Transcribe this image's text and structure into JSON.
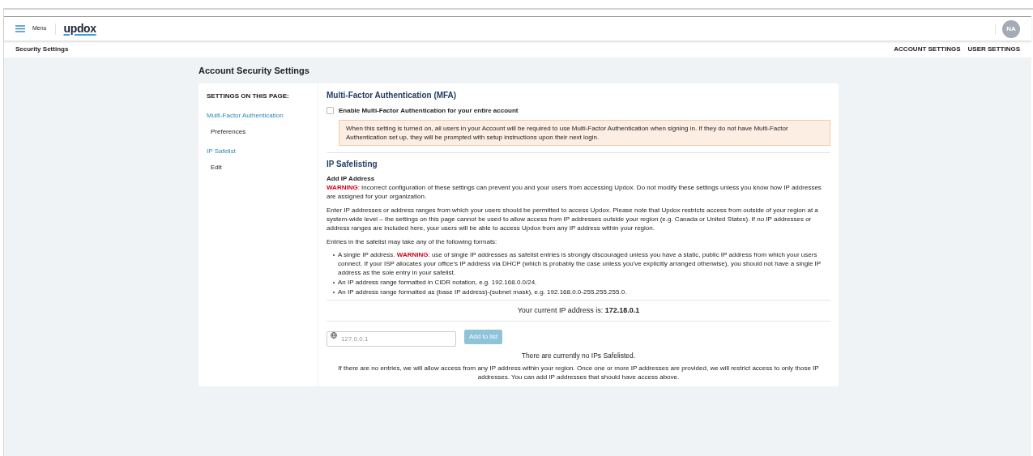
{
  "header": {
    "menu_label": "Menu",
    "logo": "updox",
    "avatar": "NA"
  },
  "subheader": {
    "title": "Security Settings",
    "links": [
      "ACCOUNT SETTINGS",
      "USER SETTINGS"
    ]
  },
  "page_title": "Account Security Settings",
  "nav": {
    "title": "SETTINGS ON THIS PAGE:",
    "sections": [
      {
        "label": "Multi-Factor Authentication",
        "children": [
          {
            "label": "Preferences"
          }
        ]
      },
      {
        "label": "IP Safelist",
        "children": [
          {
            "label": "Edit"
          }
        ]
      }
    ]
  },
  "mfa": {
    "heading": "Multi-Factor Authentication (MFA)",
    "checkbox": {
      "label": "Enable Multi-Factor Authentication for your entire account",
      "checked": false
    },
    "notice": "When this setting is turned on, all users in your Account will be required to use Multi-Factor Authentication when signing in. If they do not have Multi-Factor Authentication set up, they will be prompted with setup instructions upon their next login."
  },
  "ip": {
    "heading": "IP Safelisting",
    "subheading": "Add IP Address",
    "warning": [
      {
        "kind": "warning",
        "text": "WARNING"
      },
      {
        "kind": "plain",
        "text": ": Incorrect configuration of these settings can prevent you and your users from accessing Updox. Do not modify these settings unless you know how IP addresses are assigned for your organization."
      }
    ],
    "paragraph": "Enter IP addresses or address ranges from which your users should be permitted to access Updox. Please note that Updox restricts access from outside of your region at a system-wide level – the settings on this page cannot be used to allow access from IP addresses outside your region (e.g. Canada or United States). If no IP addresses or address ranges are included here, your users will be able to access Updox from any IP address within your region.",
    "formats_intro": "Entries in the safelist may take any of the following formats:",
    "formats": [
      [
        {
          "kind": "plain",
          "text": "A single IP address. "
        },
        {
          "kind": "warning",
          "text": "WARNING"
        },
        {
          "kind": "plain",
          "text": ": use of single IP addresses as safelist entries is strongly discouraged unless you have a static, public IP address from which your users connect. If your ISP allocates your office's IP address via DHCP (which is probably the case unless you've explicitly arranged otherwise), you should not have a single IP address as the sole entry in your safelist."
        }
      ],
      [
        {
          "kind": "plain",
          "text": "An IP address range formatted in CIDR notation, e.g. 192.168.0.0/24."
        }
      ],
      [
        {
          "kind": "plain",
          "text": "An IP address range formatted as (base IP address)-(subnet mask), e.g. 192.168.0.0-255.255.255.0."
        }
      ]
    ],
    "current_ip": "Your current IP address is: **172.18.0.1**",
    "input": {
      "placeholder": "127.0.0.1"
    },
    "add_button": {
      "label": "Add to list",
      "disabled": true
    },
    "empty_title": "There are currently no IPs Safelisted.",
    "empty_note": "If there are no entries, we will allow access from any IP address within your region. Once one or more IP addresses are provided, we will restrict access to only those IP addresses. You can add IP addresses that should have access above."
  }
}
